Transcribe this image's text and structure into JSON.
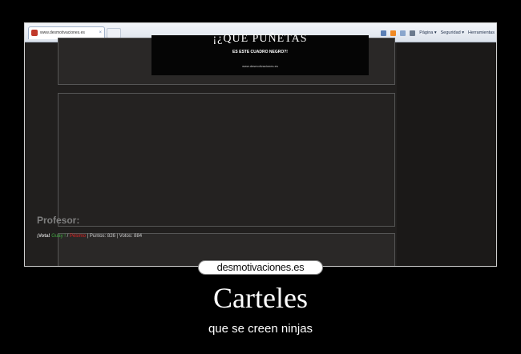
{
  "browser": {
    "tab_label": "www.desmotivaciones.es",
    "tab_close": "×",
    "tools": [
      "Página ▾",
      "Seguridad ▾",
      "Herramientas"
    ]
  },
  "poster": {
    "title": "¡¿QUE PUÑETAS",
    "subtitle": "ES ESTE CUADRO NEGRO?!",
    "url": "www.desmotivaciones.es"
  },
  "comment": {
    "author": "Profesor:",
    "vote_prefix": "¡Vota!",
    "vote_yes": "Guay !",
    "vote_sep": "/",
    "vote_no": "Pésimo",
    "stats": " | Puntos: 826 | Votos: 884"
  },
  "logo_text": "desmotivaciones.es",
  "caption": {
    "title": "Carteles",
    "subtitle": "que se creen ninjas"
  }
}
